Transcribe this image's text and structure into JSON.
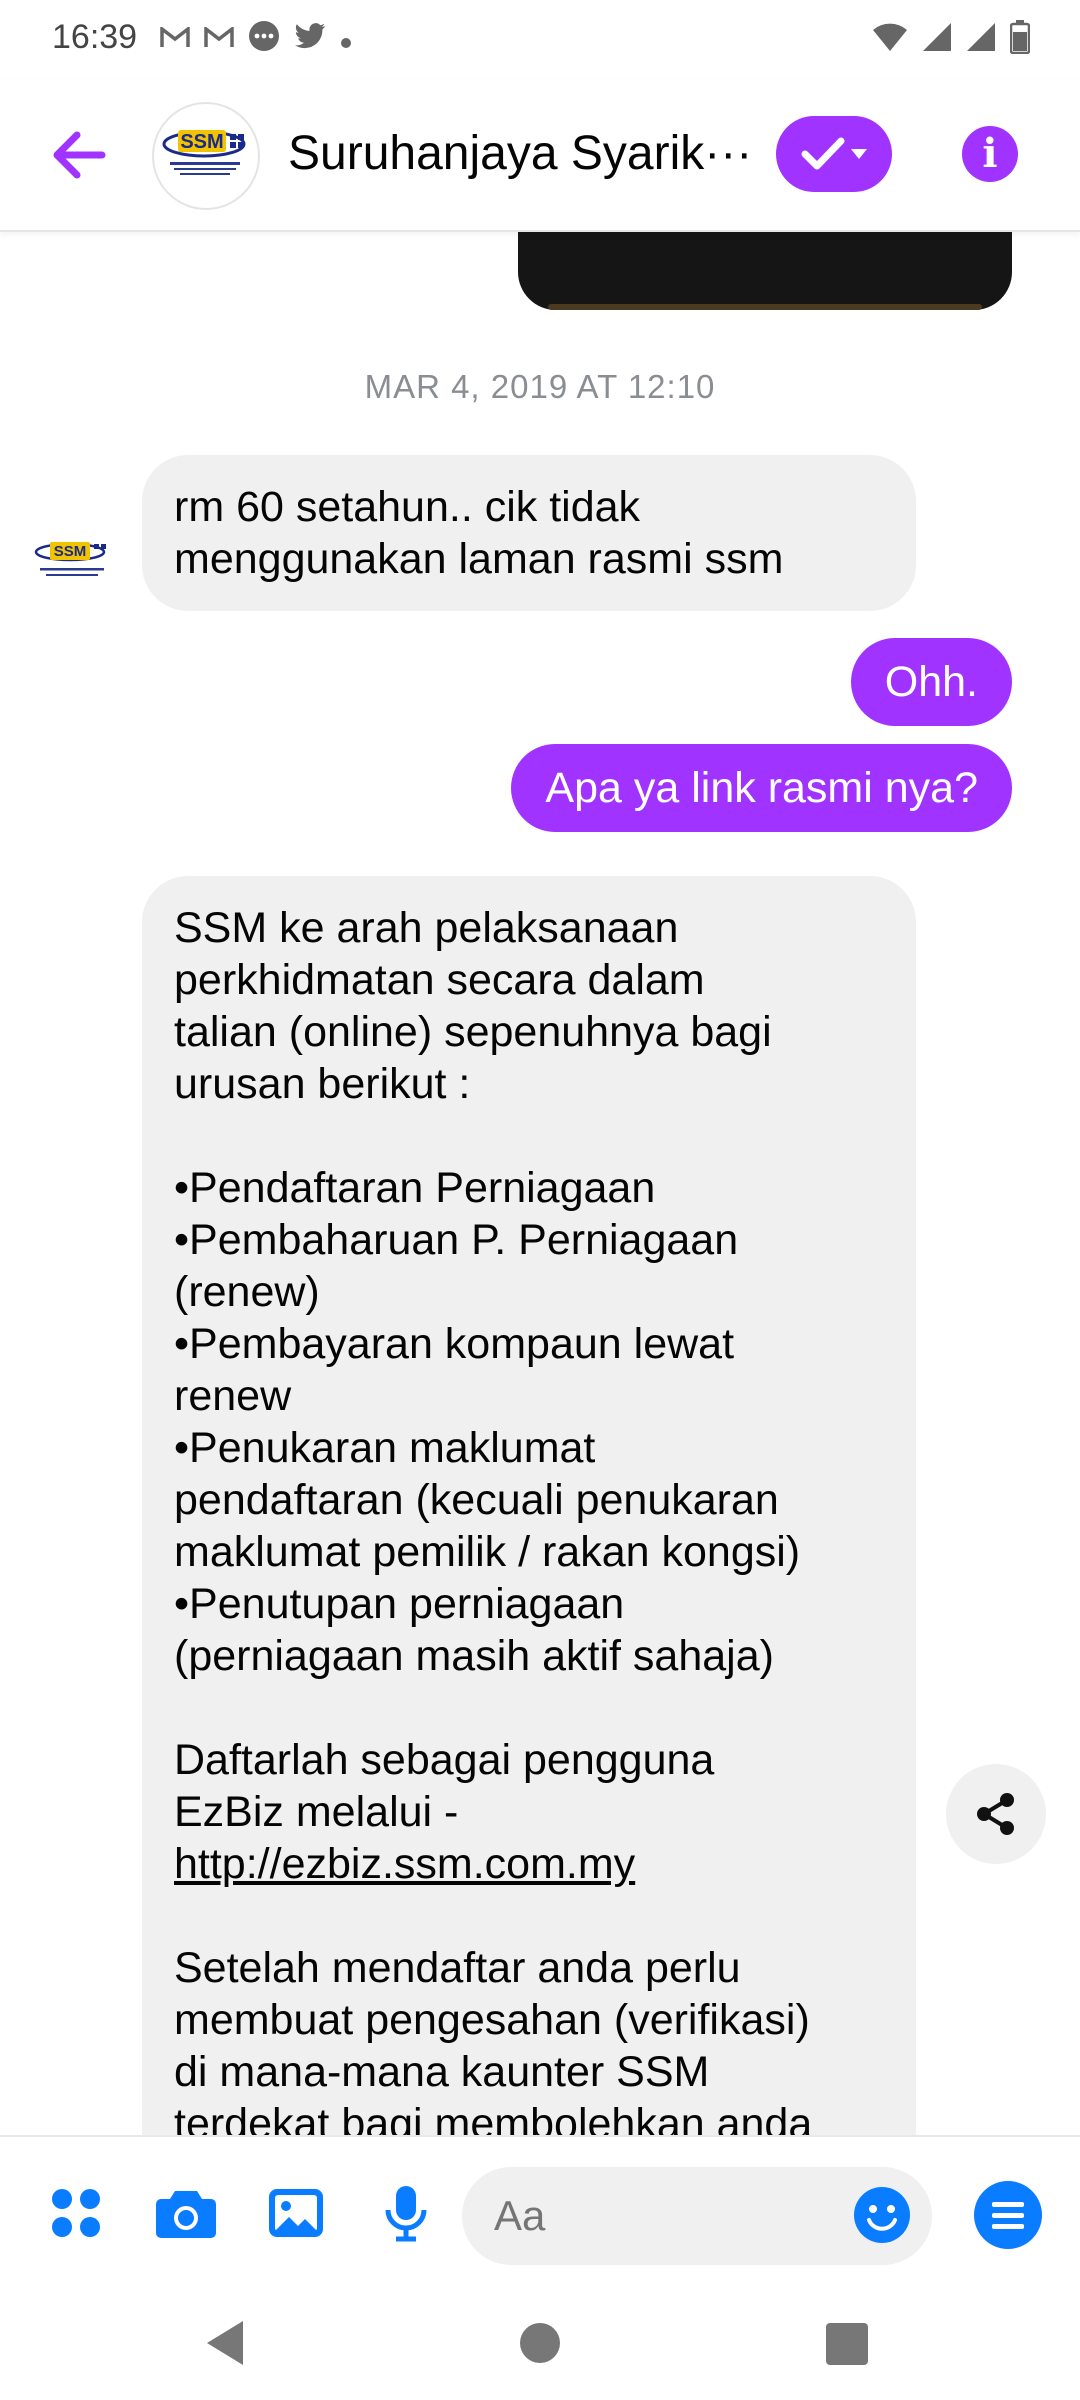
{
  "status_bar": {
    "time": "16:39",
    "left_icons": [
      "gmail-icon",
      "gmail-icon",
      "messenger-icon",
      "twitter-icon",
      "dot-icon"
    ],
    "right_icons": [
      "wifi-icon",
      "signal-icon",
      "signal-icon",
      "battery-icon"
    ]
  },
  "header": {
    "title": "Suruhanjaya Syarik···",
    "avatar_text": "SSM",
    "info_label": "i",
    "accent_color": "#a033ff"
  },
  "chat": {
    "timestamp": "MAR 4, 2019 AT 12:10",
    "messages": [
      {
        "from": "them",
        "lines": [
          "rm 60 setahun.. cik tidak",
          "menggunakan laman rasmi ssm"
        ]
      },
      {
        "from": "me",
        "text": "Ohh."
      },
      {
        "from": "me",
        "text": "Apa ya link rasmi nya?"
      },
      {
        "from": "them",
        "lines": [
          "SSM ke arah pelaksanaan",
          "perkhidmatan secara dalam",
          "talian (online) sepenuhnya bagi",
          "urusan berikut :",
          "",
          "•Pendaftaran Perniagaan",
          "•Pembaharuan P. Perniagaan",
          "(renew)",
          "•Pembayaran kompaun lewat",
          "renew",
          "•Penukaran maklumat",
          "pendaftaran (kecuali penukaran",
          "maklumat pemilik / rakan kongsi)",
          "•Penutupan perniagaan",
          "(perniagaan masih aktif sahaja)",
          "",
          "Daftarlah sebagai pengguna",
          "EzBiz melalui -",
          "http://ezbiz.ssm.com.my",
          "",
          "Setelah mendaftar anda perlu",
          "membuat pengesahan (verifikasi)",
          "di mana-mana kaunter SSM",
          "terdekat bagi membolehkan anda"
        ]
      }
    ]
  },
  "composer": {
    "placeholder": "Aa",
    "icons": [
      "apps-icon",
      "camera-icon",
      "gallery-icon",
      "microphone-icon"
    ],
    "icon_color": "#0a7cff"
  }
}
